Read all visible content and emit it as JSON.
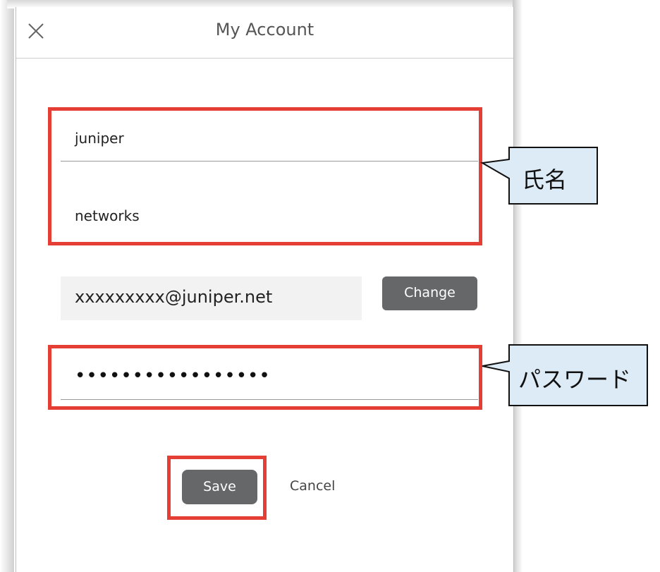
{
  "dialog": {
    "title": "My Account",
    "close_icon": "close-icon"
  },
  "form": {
    "first_name": "juniper",
    "last_name": "networks",
    "email": "xxxxxxxxx@juniper.net",
    "change_label": "Change",
    "password_masked": "•••••••••••••••••",
    "save_label": "Save",
    "cancel_label": "Cancel"
  },
  "annotations": {
    "name_callout": "氏名",
    "password_callout": "パスワード",
    "highlight_color": "#e53f35",
    "callout_fill": "#dcebf5"
  }
}
